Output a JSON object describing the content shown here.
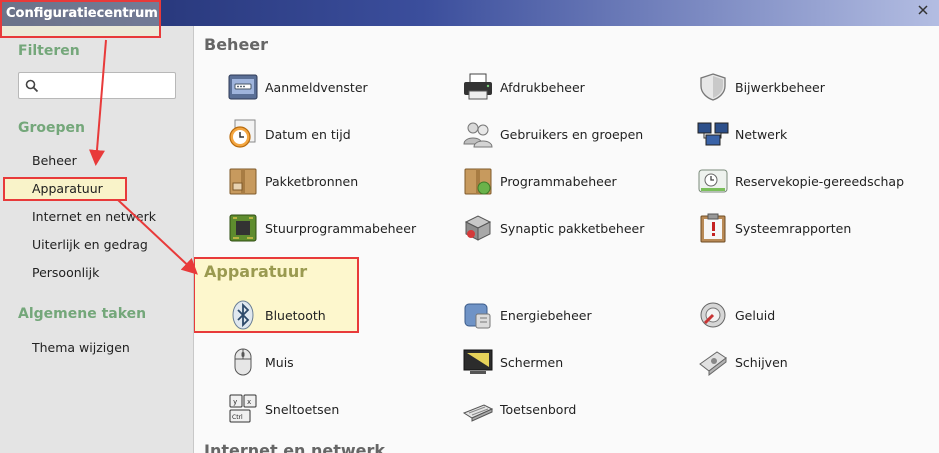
{
  "window": {
    "title": "Configuratiecentrum"
  },
  "sidebar": {
    "filter_heading": "Filteren",
    "search_placeholder": "",
    "groups_heading": "Groepen",
    "groups": [
      {
        "label": "Beheer"
      },
      {
        "label": "Apparatuur"
      },
      {
        "label": "Internet en netwerk"
      },
      {
        "label": "Uiterlijk en gedrag"
      },
      {
        "label": "Persoonlijk"
      }
    ],
    "tasks_heading": "Algemene taken",
    "tasks": [
      {
        "label": "Thema wijzigen"
      }
    ]
  },
  "main": {
    "sections": [
      {
        "title": "Beheer",
        "items": [
          {
            "label": "Aanmeldvenster",
            "icon": "login-window-icon"
          },
          {
            "label": "Afdrukbeheer",
            "icon": "printer-icon"
          },
          {
            "label": "Bijwerkbeheer",
            "icon": "shield-icon"
          },
          {
            "label": "Datum en tijd",
            "icon": "clock-icon"
          },
          {
            "label": "Gebruikers en groepen",
            "icon": "users-icon"
          },
          {
            "label": "Netwerk",
            "icon": "network-icon"
          },
          {
            "label": "Pakketbronnen",
            "icon": "package-icon"
          },
          {
            "label": "Programmabeheer",
            "icon": "software-package-icon"
          },
          {
            "label": "Reservekopie-gereedschap",
            "icon": "backup-icon"
          },
          {
            "label": "Stuurprogrammabeheer",
            "icon": "chip-icon"
          },
          {
            "label": "Synaptic pakketbeheer",
            "icon": "synaptic-icon"
          },
          {
            "label": "Systeemrapporten",
            "icon": "clipboard-alert-icon"
          }
        ]
      },
      {
        "title": "Apparatuur",
        "items": [
          {
            "label": "Bluetooth",
            "icon": "bluetooth-icon"
          },
          {
            "label": "Energiebeheer",
            "icon": "power-icon"
          },
          {
            "label": "Geluid",
            "icon": "sound-icon"
          },
          {
            "label": "Muis",
            "icon": "mouse-icon"
          },
          {
            "label": "Schermen",
            "icon": "display-icon"
          },
          {
            "label": "Schijven",
            "icon": "disks-icon"
          },
          {
            "label": "Sneltoetsen",
            "icon": "keyboard-shortcuts-icon"
          },
          {
            "label": "Toetsenbord",
            "icon": "keyboard-icon"
          }
        ]
      },
      {
        "title": "Internet en netwerk",
        "items": []
      }
    ]
  },
  "colors": {
    "highlight_border": "#e83a3a",
    "highlight_fill": "#fdf6c4",
    "sidebar_heading": "#74a77a",
    "section_heading": "#666666",
    "highlight_heading": "#9a9a50"
  }
}
